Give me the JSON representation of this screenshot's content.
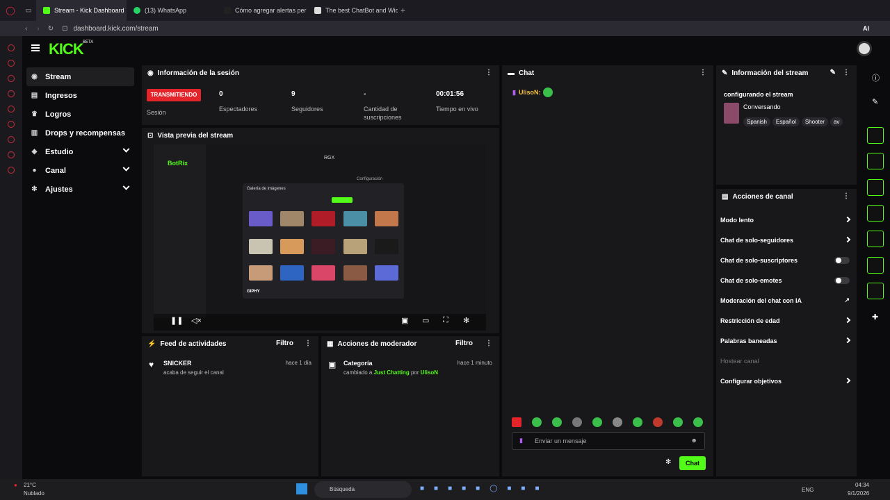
{
  "browser": {
    "tabs": [
      "Stream - Kick Dashboard",
      "(13) WhatsApp",
      "Cómo agregar alertas per",
      "The best ChatBot and Wid"
    ],
    "url": "dashboard.kick.com/stream",
    "ai": "AI"
  },
  "nav": {
    "items": [
      "Stream",
      "Ingresos",
      "Logros",
      "Drops y recompensas",
      "Estudio",
      "Canal",
      "Ajustes"
    ]
  },
  "session": {
    "title": "Información de la sesión",
    "live": "TRANSMITIENDO",
    "live_label": "Sesión",
    "stats": [
      {
        "value": "0",
        "label": "Espectadores"
      },
      {
        "value": "9",
        "label": "Seguidores"
      },
      {
        "value": "-",
        "label": "Cantidad de suscripciones"
      },
      {
        "value": "00:01:56",
        "label": "Tiempo en vivo"
      }
    ]
  },
  "preview": {
    "title": "Vista previa del stream",
    "gallery": "Galería de imágenes",
    "giphy": "GIPHY",
    "config": "Configuración",
    "brand": "BotRix",
    "rgx": "RGX"
  },
  "activity": {
    "title": "Feed de actividades",
    "filter": "Filtro",
    "user": "SNICKER",
    "time": "hace 1 día",
    "desc": "acaba de seguir el canal"
  },
  "mod": {
    "title": "Acciones de moderador",
    "filter": "Filtro",
    "item": "Categoría",
    "time": "hace 1 minuto",
    "desc_pre": "cambiado a",
    "category": "Just Chatting",
    "by": "por",
    "user": "UlisoN"
  },
  "chat": {
    "title": "Chat",
    "user": "UlisoN:",
    "placeholder": "Enviar un mensaje",
    "send": "Chat"
  },
  "stream_info": {
    "title": "Información del stream",
    "stream_title": "configurando el stream",
    "category": "Conversando",
    "tags": [
      "Spanish",
      "Español",
      "Shooter",
      "av"
    ]
  },
  "actions": {
    "title": "Acciones de canal",
    "items": [
      {
        "label": "Modo lento",
        "type": "arrow"
      },
      {
        "label": "Chat de solo-seguidores",
        "type": "arrow"
      },
      {
        "label": "Chat de solo-suscriptores",
        "type": "toggle"
      },
      {
        "label": "Chat de solo-emotes",
        "type": "toggle"
      },
      {
        "label": "Moderación del chat con IA",
        "type": "ext"
      },
      {
        "label": "Restricción de edad",
        "type": "arrow"
      },
      {
        "label": "Palabras baneadas",
        "type": "arrow"
      },
      {
        "label": "Hostear canal",
        "type": "disabled"
      },
      {
        "label": "Configurar objetivos",
        "type": "arrow"
      }
    ]
  },
  "taskbar": {
    "temp": "21°C",
    "weather": "Nublado",
    "search": "Búsqueda",
    "lang": "ENG",
    "time": "04:34",
    "date": "9/1/2026"
  },
  "colors": {
    "accent": "#53fc18",
    "live": "#e3242b",
    "panel": "#18181b"
  }
}
